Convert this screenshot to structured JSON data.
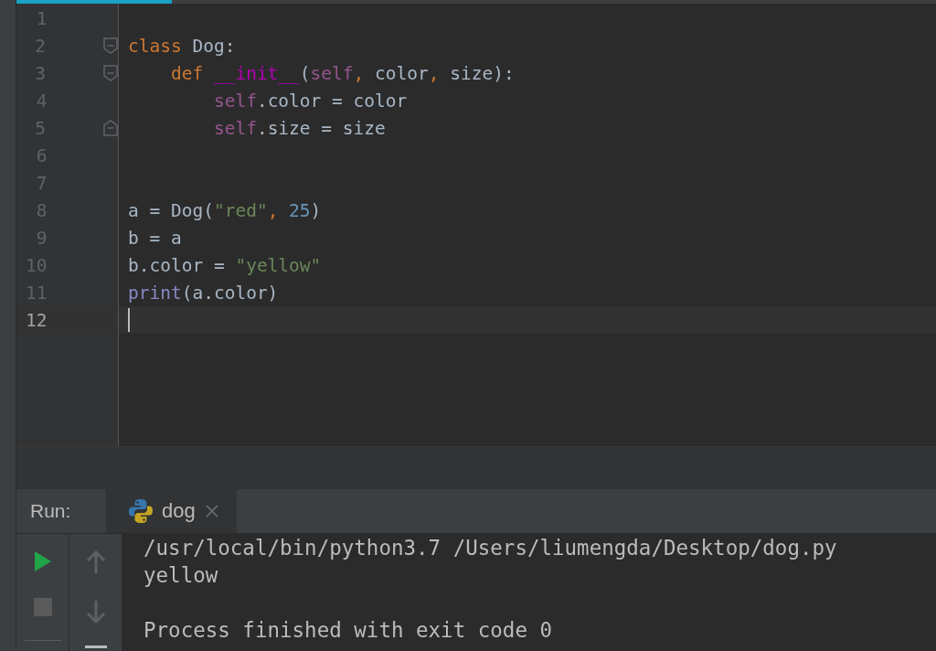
{
  "editor": {
    "lines": [
      {
        "number": "1"
      },
      {
        "number": "2",
        "fold_start": true,
        "tokens": [
          {
            "text": "class ",
            "kind": "keyword"
          },
          {
            "text": "Dog:",
            "kind": "plain"
          }
        ]
      },
      {
        "number": "3",
        "fold_start": true,
        "tokens": [
          {
            "text": "    def ",
            "kind": "keyword"
          },
          {
            "text": "__init__",
            "kind": "magic"
          },
          {
            "text": "(",
            "kind": "plain"
          },
          {
            "text": "self",
            "kind": "self"
          },
          {
            "text": ", ",
            "kind": "keyword"
          },
          {
            "text": "color",
            "kind": "plain"
          },
          {
            "text": ", ",
            "kind": "keyword"
          },
          {
            "text": "size):",
            "kind": "plain"
          }
        ]
      },
      {
        "number": "4",
        "tokens": [
          {
            "text": "        self",
            "kind": "self"
          },
          {
            "text": ".color = color",
            "kind": "plain"
          }
        ]
      },
      {
        "number": "5",
        "fold_end": true,
        "tokens": [
          {
            "text": "        self",
            "kind": "self"
          },
          {
            "text": ".size = size",
            "kind": "plain"
          }
        ]
      },
      {
        "number": "6"
      },
      {
        "number": "7"
      },
      {
        "number": "8",
        "tokens": [
          {
            "text": "a = Dog(",
            "kind": "plain"
          },
          {
            "text": "\"red\"",
            "kind": "string"
          },
          {
            "text": ", ",
            "kind": "keyword"
          },
          {
            "text": "25",
            "kind": "number"
          },
          {
            "text": ")",
            "kind": "plain"
          }
        ]
      },
      {
        "number": "9",
        "tokens": [
          {
            "text": "b = a",
            "kind": "plain"
          }
        ]
      },
      {
        "number": "10",
        "tokens": [
          {
            "text": "b.color = ",
            "kind": "plain"
          },
          {
            "text": "\"yellow\"",
            "kind": "string"
          }
        ]
      },
      {
        "number": "11",
        "tokens": [
          {
            "text": "print",
            "kind": "builtin"
          },
          {
            "text": "(a.color)",
            "kind": "plain"
          }
        ]
      },
      {
        "number": "12",
        "current": true
      }
    ]
  },
  "run_panel": {
    "label": "Run:",
    "tabs": [
      {
        "title": "dog",
        "selected": true
      }
    ],
    "console": [
      {
        "text": "/usr/local/bin/python3.7 /Users/liumengda/Desktop/dog.py"
      },
      {
        "text": "yellow"
      },
      {
        "text": "Process finished with exit code 0",
        "blank_before": true
      }
    ]
  }
}
